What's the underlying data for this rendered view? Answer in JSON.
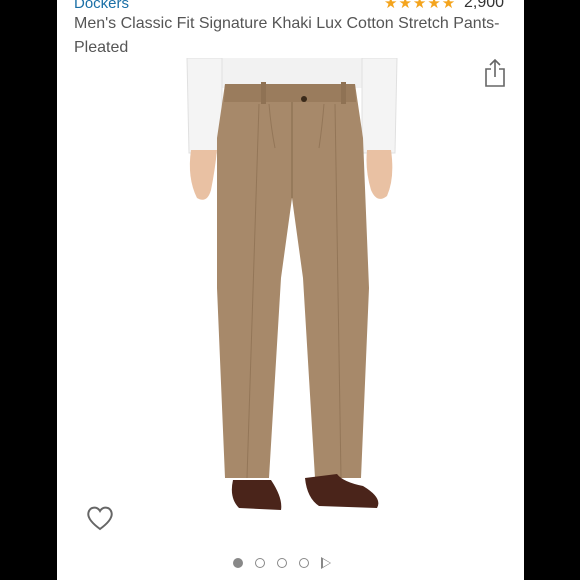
{
  "product": {
    "brand": "Dockers",
    "rating_stars": "★★★★★",
    "rating_count": "2,900",
    "title": "Men's Classic Fit Signature Khaki Lux Cotton Stretch Pants-Pleated"
  },
  "carousel": {
    "slide_count": 4,
    "active_index": 0,
    "has_video": true
  },
  "icons": {
    "share": "share-icon",
    "wishlist": "heart-icon"
  },
  "colors": {
    "brand_link": "#1a6fa6",
    "star": "#f4a41d",
    "pants": "#a7896a",
    "shirt": "#f2f2f2",
    "shoes": "#4a241a"
  }
}
